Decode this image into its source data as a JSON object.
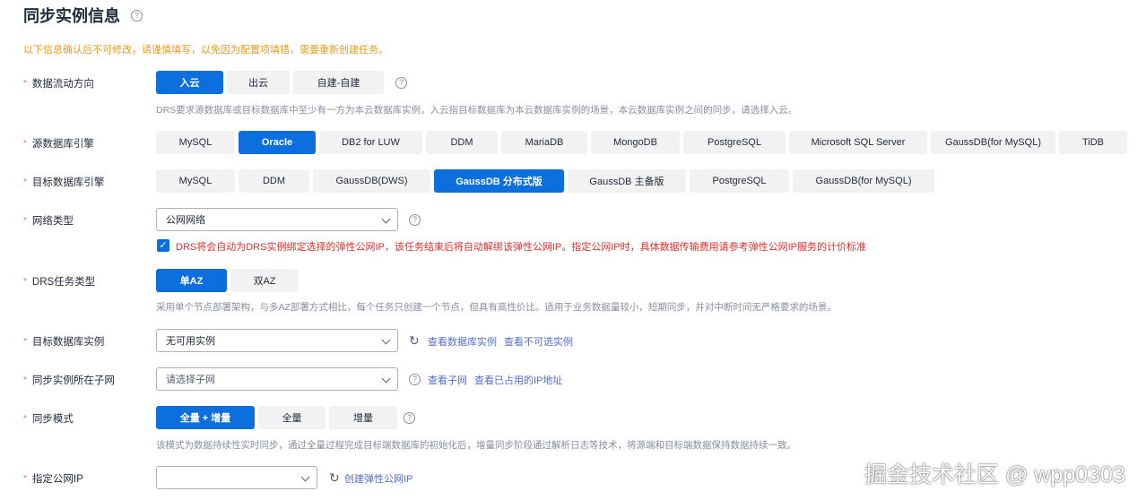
{
  "header": {
    "title": "同步实例信息",
    "help": "?"
  },
  "warning": "以下信息确认后不可修改，请谨慎填写，以免因为配置项填错，需要重新创建任务。",
  "flow": {
    "label": "数据流动方向",
    "options": [
      "入云",
      "出云",
      "自建-自建"
    ],
    "selected": "入云",
    "desc": "DRS要求源数据库或目标数据库中至少有一方为本云数据库实例，入云指目标数据库为本云数据库实例的场景，本云数据库实例之间的同步，请选择入云。"
  },
  "source_engine": {
    "label": "源数据库引擎",
    "options": [
      "MySQL",
      "Oracle",
      "DB2 for LUW",
      "DDM",
      "MariaDB",
      "MongoDB",
      "PostgreSQL",
      "Microsoft SQL Server",
      "GaussDB(for MySQL)",
      "TiDB"
    ],
    "selected": "Oracle"
  },
  "target_engine": {
    "label": "目标数据库引擎",
    "options": [
      "MySQL",
      "DDM",
      "GaussDB(DWS)",
      "GaussDB 分布式版",
      "GaussDB 主备版",
      "PostgreSQL",
      "GaussDB(for MySQL)"
    ],
    "selected": "GaussDB 分布式版"
  },
  "network": {
    "label": "网络类型",
    "value": "公网网络",
    "checkbox_text": "DRS将会自动为DRS实例绑定选择的弹性公网IP，该任务结束后将自动解绑该弹性公网IP。指定公网IP时，具体数据传输费用请参考弹性公网IP服务的计价标准",
    "checked": true
  },
  "task_type": {
    "label": "DRS任务类型",
    "options": [
      "单AZ",
      "双AZ"
    ],
    "selected": "单AZ",
    "desc": "采用单个节点部署架构，与多AZ部署方式相比，每个任务只创建一个节点，但具有高性价比。适用于业务数据量较小，短期同步，并对中断时间无严格要求的场景。"
  },
  "target_instance": {
    "label": "目标数据库实例",
    "value": "无可用实例",
    "links": [
      "查看数据库实例",
      "查看不可选实例"
    ]
  },
  "subnet": {
    "label": "同步实例所在子网",
    "placeholder": "请选择子网",
    "links": [
      "查看子网",
      "查看已占用的IP地址"
    ]
  },
  "sync_mode": {
    "label": "同步模式",
    "options": [
      "全量 + 增量",
      "全量",
      "增量"
    ],
    "selected": "全量 + 增量",
    "desc": "该模式为数据持续性实时同步，通过全量过程完成目标端数据库的初始化后，增量同步阶段通过解析日志等技术，将源端和目标端数据保持数据持续一致。"
  },
  "public_ip": {
    "label": "指定公网IP",
    "value": "",
    "link": "创建弹性公网IP"
  },
  "watermark": "掘金技术社区 @ wpp0303",
  "colors": {
    "primary": "#0d6fde",
    "warning": "#e89a1c",
    "error_text": "#e0302b",
    "link": "#526ecc",
    "required": "#f66f6a"
  }
}
